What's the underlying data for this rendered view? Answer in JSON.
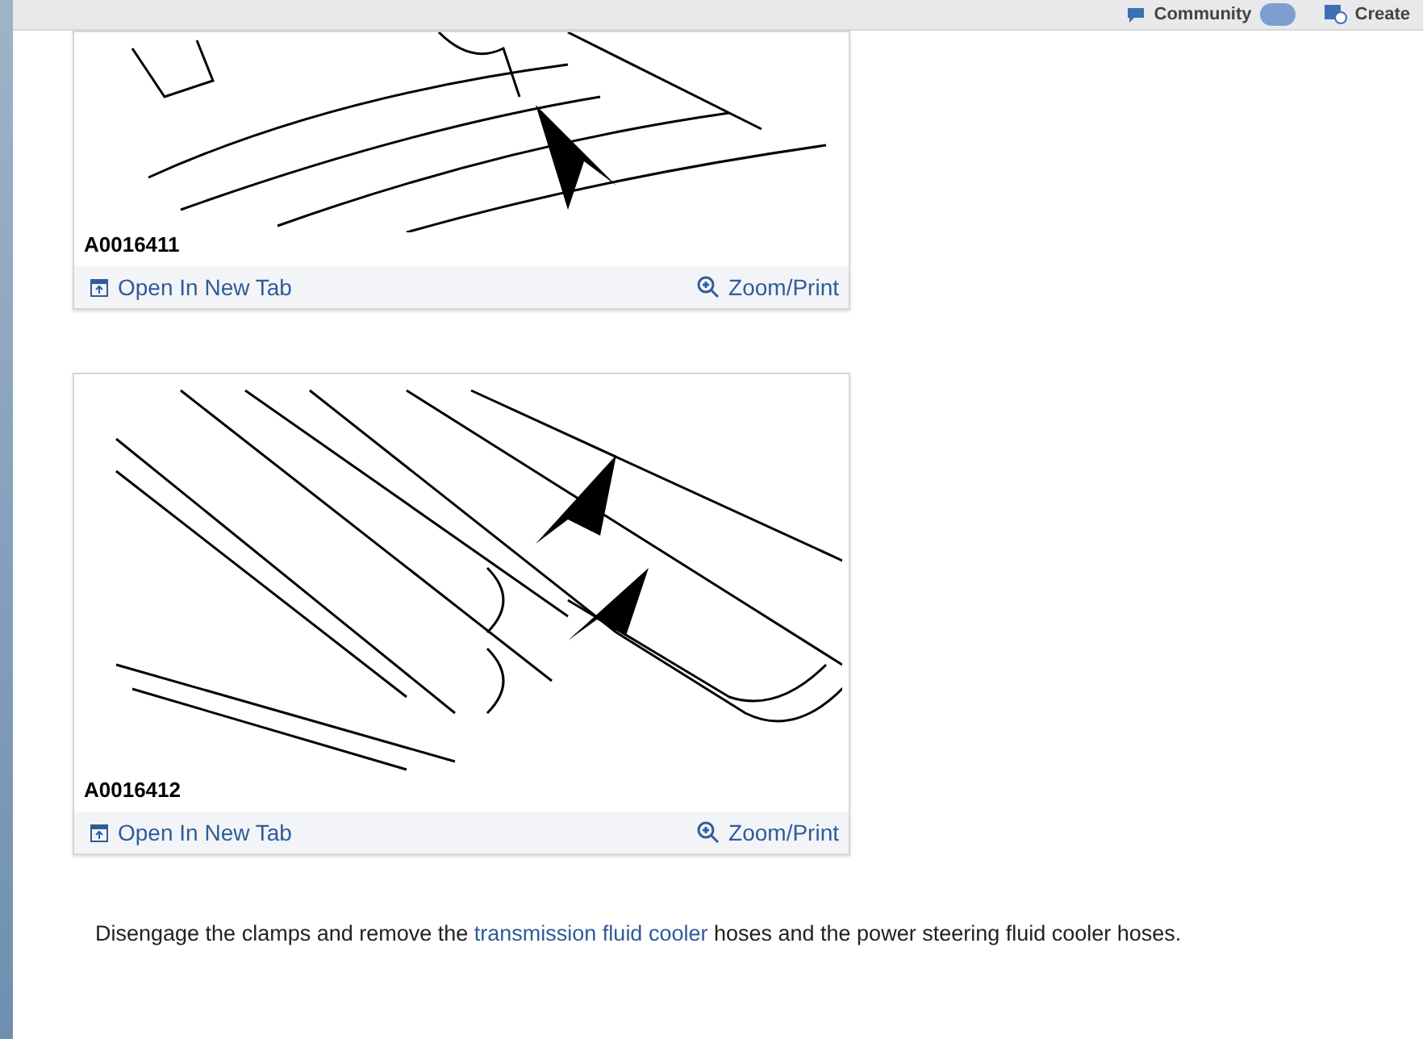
{
  "header": {
    "community": "Community",
    "create": "Create"
  },
  "figures": [
    {
      "caption": "A0016411",
      "open_link": "Open In New Tab",
      "zoom_link": "Zoom/Print"
    },
    {
      "caption": "A0016412",
      "open_link": "Open In New Tab",
      "zoom_link": "Zoom/Print"
    }
  ],
  "paragraph": {
    "before": "Disengage the clamps and remove the",
    "link": "transmission fluid cooler",
    "after": "hoses and the power steering fluid cooler hoses."
  }
}
